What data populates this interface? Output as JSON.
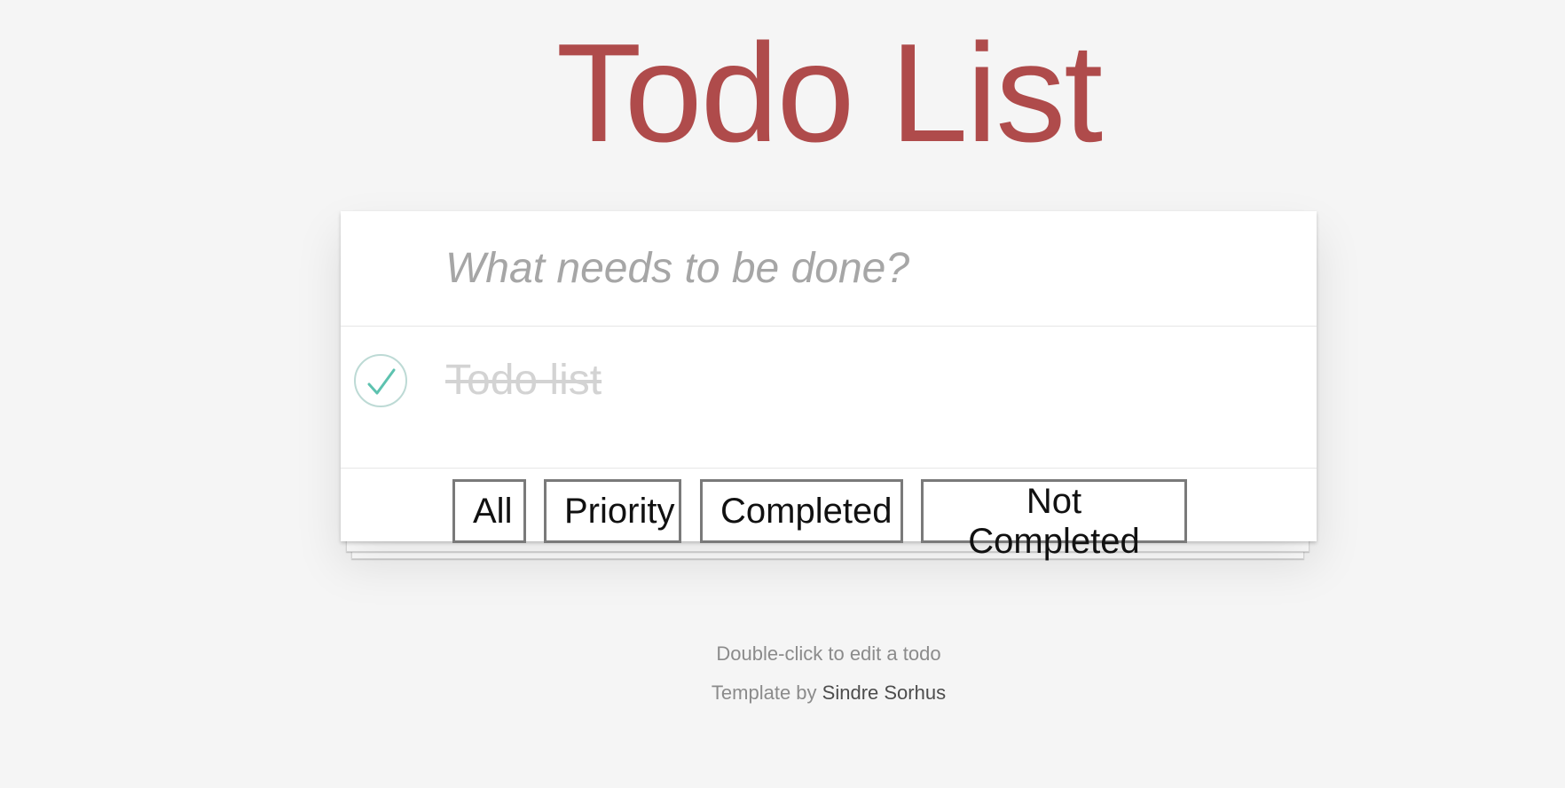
{
  "header": {
    "title": "Todo List"
  },
  "new_todo": {
    "placeholder": "What needs to be done?",
    "value": ""
  },
  "todos": [
    {
      "label": "Todo list",
      "completed": true
    }
  ],
  "filters": [
    {
      "label": "All"
    },
    {
      "label": "Priority"
    },
    {
      "label": "Completed"
    },
    {
      "label": "Not Completed"
    }
  ],
  "footer": {
    "hint": "Double-click to edit a todo",
    "credit_prefix": "Template by",
    "author": "Sindre Sorhus"
  },
  "colors": {
    "title": "#af4b4b",
    "check": "#5dc2af",
    "check_border": "#bddad5",
    "completed_text": "#d3d3d3",
    "background": "#f5f5f5"
  }
}
